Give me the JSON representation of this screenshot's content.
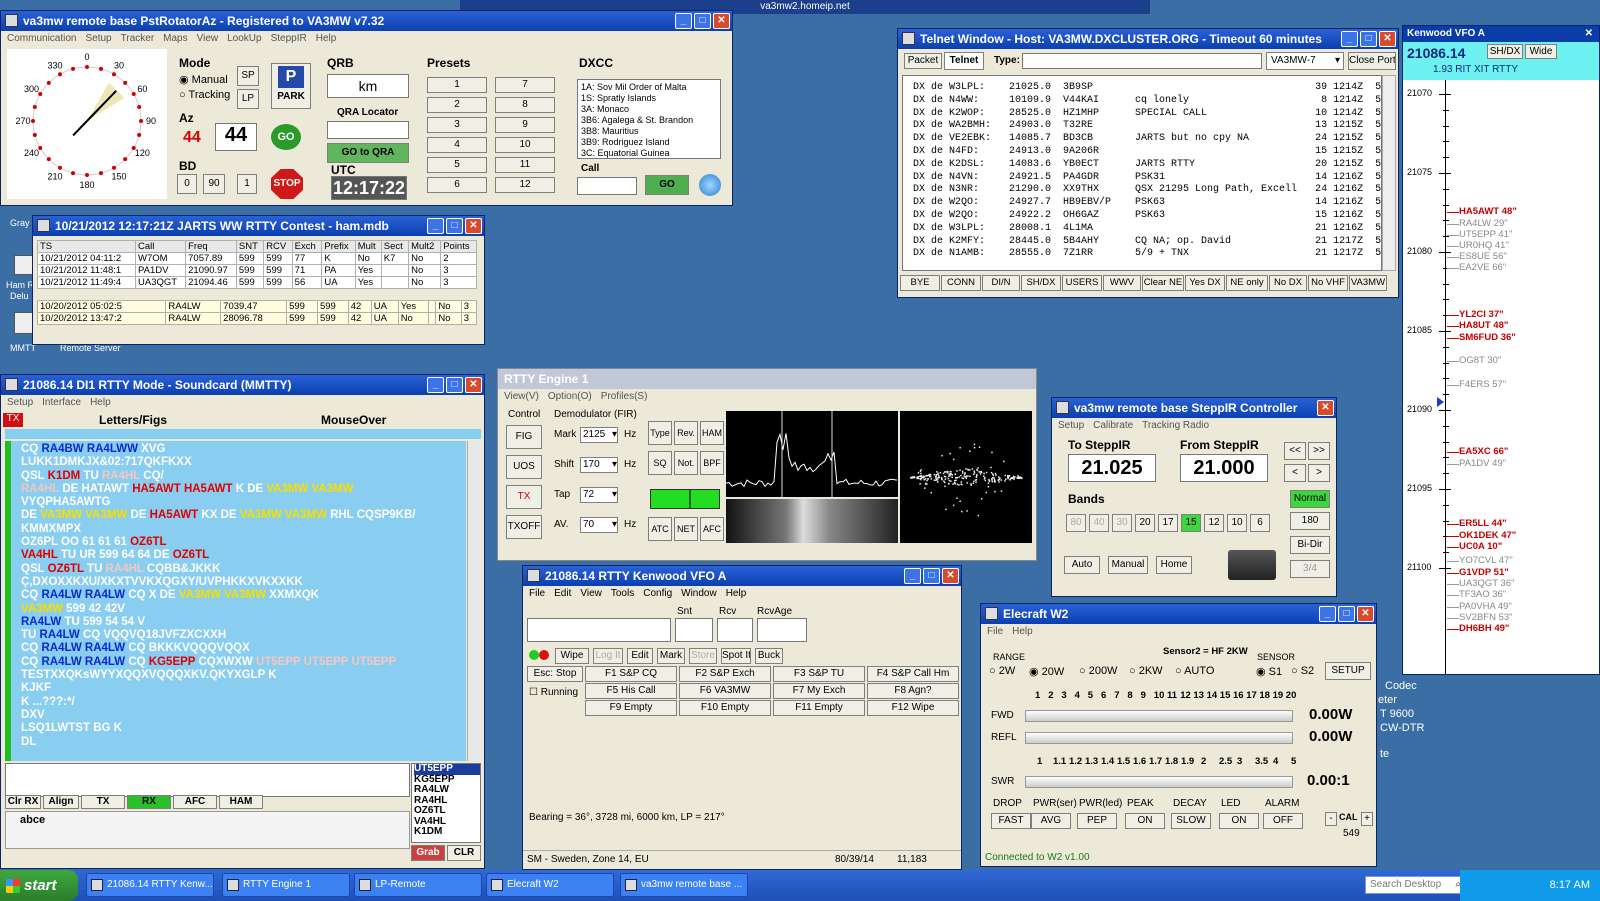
{
  "desktop": {
    "topbar_host": "va3mw2.homeip.net",
    "side_texts": [
      "Gray",
      "Ham R",
      "Delu",
      "MMTT",
      "Remote Server"
    ],
    "right_texts": [
      "Codec",
      "eter",
      "T 9600",
      "CW-DTR",
      "te"
    ]
  },
  "rotator": {
    "title": "va3mw remote base PstRotatorAz - Registered to VA3MW   v7.32",
    "menu": [
      "Communication",
      "Setup",
      "Tracker",
      "Maps",
      "View",
      "LookUp",
      "SteppIR",
      "Help"
    ],
    "compass": {
      "marks": [
        "330",
        "0",
        "30",
        "60",
        "90",
        "120",
        "150",
        "180",
        "210",
        "240",
        "270",
        "300"
      ],
      "heading_deg": 44
    },
    "mode_label": "Mode",
    "manual": "Manual",
    "tracking": "Tracking",
    "sp": "SP",
    "lp": "LP",
    "park": "PARK",
    "az_label": "Az",
    "az_value": "44",
    "az_input": "44",
    "go": "GO",
    "bd_label": "BD",
    "bd": [
      "0",
      "90",
      "1"
    ],
    "stop": "STOP",
    "qrb_label": "QRB",
    "km": "km",
    "qra_label": "QRA Locator",
    "go_qra": "GO to QRA",
    "utc_label": "UTC",
    "utc": "12:17:22",
    "presets_label": "Presets",
    "presets": [
      "1",
      "7",
      "2",
      "8",
      "3",
      "9",
      "4",
      "10",
      "5",
      "11",
      "6",
      "12"
    ],
    "dxcc_label": "DXCC",
    "dxcc": [
      "1A:  Sov Mil Order of Malta",
      "1S:  Spratly Islands",
      "3A:  Monaco",
      "3B6:  Agalega & St. Brandon",
      "3B8:  Mauritius",
      "3B9:  Rodriguez Island",
      "3C:  Equatorial Guinea"
    ],
    "call_label": "Call",
    "call_go": "GO"
  },
  "log": {
    "title": "10/21/2012 12:17:21Z  JARTS WW RTTY Contest - ham.mdb",
    "cols": [
      "TS",
      "Call",
      "Freq",
      "SNT",
      "RCV",
      "Exch",
      "Prefix",
      "Mult",
      "Sect",
      "Mult2",
      "Points"
    ],
    "rows": [
      [
        "10/21/2012 04:11:2",
        "W7OM",
        "7057.89",
        "599",
        "599",
        "77",
        "K",
        "No",
        "K7",
        "No",
        "2"
      ],
      [
        "10/21/2012 11:48:1",
        "PA1DV",
        "21090.97",
        "599",
        "599",
        "71",
        "PA",
        "Yes",
        "",
        "No",
        "3"
      ],
      [
        "10/21/2012 11:49:4",
        "UA3QGT",
        "21094.46",
        "599",
        "599",
        "56",
        "UA",
        "Yes",
        "",
        "No",
        "3"
      ]
    ],
    "rows2": [
      [
        "10/20/2012 05:02:5",
        "RA4LW",
        "7039.47",
        "599",
        "599",
        "42",
        "UA",
        "Yes",
        "",
        "No",
        "3"
      ],
      [
        "10/20/2012 13:47:2",
        "RA4LW",
        "28096.78",
        "599",
        "599",
        "42",
        "UA",
        "No",
        "",
        "No",
        "3"
      ]
    ]
  },
  "mmtty": {
    "title": "21086.14  DI1 RTTY Mode - Soundcard (MMTTY)",
    "menu": [
      "Setup",
      "Interface",
      "Help"
    ],
    "tx": "TX",
    "letters": "Letters/Figs",
    "mouseover": "MouseOver",
    "lines": [
      [
        [
          "CQ ",
          "w"
        ],
        [
          "RA4BW RA4LWW",
          "b"
        ],
        [
          " XVG",
          "w"
        ]
      ],
      [
        [
          "LUKK1DMKJX&02:717QKFKXX",
          "w"
        ]
      ],
      [
        [
          " QSL ",
          "w"
        ],
        [
          "K1DM",
          "r"
        ],
        [
          " TU ",
          "w"
        ],
        [
          "RA4HL",
          "g"
        ],
        [
          " CQ/",
          "w"
        ]
      ],
      [
        [
          "RA4HL",
          "g"
        ],
        [
          " DE HATAWT ",
          "w"
        ],
        [
          "HA5AWT HA5AWT",
          "r"
        ],
        [
          " K DE ",
          "w"
        ],
        [
          "VA3MW VA3MW",
          "y"
        ]
      ],
      [
        [
          "VYQPHA5AWTG",
          "w"
        ]
      ],
      [
        [
          " DE ",
          "w"
        ],
        [
          "VA3MW VA3MW",
          "y"
        ],
        [
          " DE ",
          "w"
        ],
        [
          "HA5AWT",
          "r"
        ],
        [
          " KX DE ",
          "w"
        ],
        [
          "VA3MW VA3MW",
          "y"
        ],
        [
          " RHL CQSP9KB/",
          "w"
        ]
      ],
      [
        [
          " KMMXMPX",
          "w"
        ]
      ],
      [
        [
          " OZ6PL OO 61 61 61 ",
          "w"
        ],
        [
          "OZ6TL",
          "r"
        ]
      ],
      [
        [
          "VA4HL",
          "r"
        ],
        [
          " TU UR 599 64 64 DE ",
          "w"
        ],
        [
          "OZ6TL",
          "r"
        ]
      ],
      [
        [
          " QSL ",
          "w"
        ],
        [
          "OZ6TL",
          "r"
        ],
        [
          " TU ",
          "w"
        ],
        [
          "RA4HL",
          "g"
        ],
        [
          " CQBB&JKKK",
          "w"
        ]
      ],
      [
        [
          "Ç,DXOXXKXU/XKXTVVKXQGXY/UVPHKKXVKXXKK",
          "w"
        ]
      ],
      [
        [
          "CQ ",
          "w"
        ],
        [
          "RA4LW RA4LW",
          "b"
        ],
        [
          " CQ X DE ",
          "w"
        ],
        [
          "VA3MW VA3MW",
          "y"
        ],
        [
          " XXMXQK",
          "w"
        ]
      ],
      [
        [
          "VA3MW",
          "y"
        ],
        [
          " 599 42 42V",
          "w"
        ]
      ],
      [
        [
          "RA4LW",
          "b"
        ],
        [
          " TU 599 54 54 V",
          "w"
        ]
      ],
      [
        [
          "TU ",
          "w"
        ],
        [
          "RA4LW",
          "b"
        ],
        [
          " CQ VQQVQ18JVFZXCXXH",
          "w"
        ]
      ],
      [
        [
          "CQ ",
          "w"
        ],
        [
          "RA4LW RA4LW",
          "b"
        ],
        [
          " CQ BKKKVQQQVQQX",
          "w"
        ]
      ],
      [
        [
          "CQ ",
          "w"
        ],
        [
          "RA4LW RA4LW",
          "b"
        ],
        [
          " CQ ",
          "w"
        ],
        [
          "KG5EPP",
          "r"
        ],
        [
          " CQXWXW ",
          "w"
        ],
        [
          "UT5EPP UT5EPP UT5EPP",
          "g"
        ]
      ],
      [
        [
          "TESTXXQKsWYYXQQXVQQQXKV.QKYXGLP K",
          "w"
        ]
      ],
      [
        [
          "KJKF",
          "w"
        ]
      ],
      [
        [
          " K ...???:*/",
          "w"
        ]
      ],
      [
        [
          "DXV",
          "w"
        ]
      ],
      [
        [
          "LSQ1LWTST BG  K",
          "w"
        ]
      ],
      [
        [
          " DL",
          "w"
        ]
      ]
    ],
    "calls": [
      "UT5EPP",
      "KG5EPP",
      "RA4LW",
      "RA4HL",
      "OZ6TL",
      "VA4HL",
      "K1DM"
    ],
    "bottom": [
      "Clr RX",
      "Align",
      "TX",
      "RX",
      "AFC",
      "HAM"
    ],
    "abce": "abce",
    "grab": "Grab",
    "clr": "CLR"
  },
  "engine": {
    "title": "RTTY Engine 1",
    "menu": [
      "View(V)",
      "Option(O)",
      "Profiles(S)"
    ],
    "control": "Control",
    "fig": "FIG",
    "uos": "UOS",
    "tx": "TX",
    "txoff": "TXOFF",
    "demod": "Demodulator (FIR)",
    "mark_l": "Mark",
    "mark": "2125",
    "shift_l": "Shift",
    "shift": "170",
    "tap_l": "Tap",
    "tap": "72",
    "av_l": "AV.",
    "av": "70",
    "hz": "Hz",
    "btns": [
      "Type",
      "Rev.",
      "HAM",
      "SQ",
      "Not.",
      "BPF",
      "ATC",
      "NET",
      "AFC"
    ]
  },
  "telnet": {
    "title": "Telnet Window - Host: VA3MW.DXCLUSTER.ORG - Timeout 60 minutes",
    "packet": "Packet",
    "telnet": "Telnet",
    "type": "Type:",
    "call": "VA3MW-7",
    "close": "Close Port",
    "lines": [
      "DX de W3LPL:    21025.0  3B9SP                                     39 1214Z  5",
      "DX de N4WW:     10109.9  V44KAI      cq lonely                      8 1214Z  5",
      "DX de K2WOP:    28525.0  HZ1MHP      SPECIAL CALL                  10 1214Z  5",
      "DX de WA2BMH:   24903.0  T32RE                                     13 1215Z  5",
      "DX de VE2EBK:   14085.7  BD3CB       JARTS but no cpy NA           24 1215Z  5",
      "DX de N4FD:     24913.0  9A206R                                    15 1215Z  5",
      "DX de K2DSL:    14083.6  YB0ECT      JARTS RTTY                    20 1215Z  5",
      "DX de N4VN:     24921.5  PA4GDR      PSK31                         14 1216Z  5",
      "DX de N3NR:     21290.0  XX9THX      QSX 21295 Long Path, Excell   24 1216Z  5",
      "DX de W2QO:     24927.7  HB9EBV/P    PSK63                         14 1216Z  5",
      "DX de W2QO:     24922.2  OH6GAZ      PSK63                         15 1216Z  5",
      "DX de W3LPL:    28008.1  4L1MA                                     21 1216Z  5",
      "DX de K2MFY:    28445.0  5B4AHY      CQ NA; op. David              21 1217Z  5",
      "DX de N1AMB:    28555.0  7Z1RR       5/9 + TNX                     21 1217Z  5"
    ],
    "buttons": [
      "BYE",
      "CONN",
      "DI/N",
      "SH/DX",
      "USERS",
      "WWV",
      "Clear NE",
      "Yes DX",
      "NE only",
      "No DX",
      "No VHF",
      "VA3MW"
    ]
  },
  "vfo": {
    "title": "Kenwood VFO A",
    "freq": "21086.14",
    "shdx": "SH/DX",
    "wide": "Wide",
    "sub": "1.93  RIT  XIT  RTTY",
    "ticks": [
      "21070",
      "21075",
      "21080",
      "21085",
      "21090",
      "21095",
      "21100"
    ],
    "spots": [
      [
        "HA5AWT 48\"",
        "r"
      ],
      [
        "RA4LW 29\"",
        "g"
      ],
      [
        "UT5EPP 41\"",
        "g"
      ],
      [
        "UR0HQ 41\"",
        "g"
      ],
      [
        "ES8UE 56\"",
        "g"
      ],
      [
        "EA2VE 66\"",
        "g"
      ],
      [
        "YL2CI 37\"",
        "r"
      ],
      [
        "HA8UT 48\"",
        "r"
      ],
      [
        "SM6FUD 36\"",
        "r"
      ],
      [
        "OG8T 30\"",
        "g"
      ],
      [
        "F4ERS 57\"",
        "g"
      ],
      [
        "EA5XC 66\"",
        "r"
      ],
      [
        "PA1DV 49\"",
        "g"
      ],
      [
        "ER5LL 44\"",
        "r"
      ],
      [
        "OK1DEK 47\"",
        "r"
      ],
      [
        "UC0A 10\"",
        "r"
      ],
      [
        "YO7CVL 47\"",
        "g"
      ],
      [
        "G1VDP 51\"",
        "r"
      ],
      [
        "UA3QGT 36\"",
        "g"
      ],
      [
        "TF3AO 36\"",
        "g"
      ],
      [
        "PA0VHA 49\"",
        "g"
      ],
      [
        "SV2BFN 53\"",
        "g"
      ],
      [
        "DH6BH 49\"",
        "r"
      ]
    ]
  },
  "steppir": {
    "title": "va3mw remote base SteppIR Controller",
    "menu": [
      "Setup",
      "Calibrate",
      "Tracking Radio"
    ],
    "to": "To SteppIR",
    "from": "From SteppIR",
    "to_val": "21.025",
    "from_val": "21.000",
    "bands_label": "Bands",
    "bands": [
      "80",
      "40",
      "30",
      "20",
      "17",
      "15",
      "12",
      "10",
      "6"
    ],
    "normal": "Normal",
    "d180": "180",
    "bidir": "Bi-Dir",
    "d34": "3/4",
    "auto": "Auto",
    "manual": "Manual",
    "home": "Home",
    "arrows": [
      "<<",
      ">>",
      "<",
      ">"
    ]
  },
  "kenwood": {
    "title": "21086.14  RTTY Kenwood VFO A",
    "menu": [
      "File",
      "Edit",
      "View",
      "Tools",
      "Config",
      "Window",
      "Help"
    ],
    "snt": "Snt",
    "rcv": "Rcv",
    "rcvage": "RcvAge",
    "tools": [
      "Wipe",
      "Log It",
      "Edit",
      "Mark",
      "Store",
      "Spot It",
      "Buck"
    ],
    "fkeys": [
      "Esc: Stop",
      "F1 S&P CQ",
      "F2 S&P Exch",
      "F3 S&P TU",
      "F4 S&P Call Hm",
      "F5 His Call",
      "F6 VA3MW",
      "F7 My Exch",
      "F8 Agn?",
      "F9 Empty",
      "F10 Empty",
      "F11 Empty",
      "F12 Wipe"
    ],
    "running": "Running",
    "bearing": "Bearing = 36°, 3728  mi, 6000 km, LP = 217°",
    "status": [
      "SM - Sweden, Zone 14, EU",
      "80/39/14",
      "11,183"
    ]
  },
  "elecraft": {
    "title": "Elecraft W2",
    "menu": [
      "File",
      "Help"
    ],
    "range": "RANGE",
    "ranges": [
      "2W",
      "20W",
      "200W",
      "2KW",
      "AUTO"
    ],
    "sensor_t": "Sensor2 = HF 2KW",
    "sensor": "SENSOR",
    "s1": "S1",
    "s2": "S2",
    "setup": "SETUP",
    "scale1": [
      "1",
      "2",
      "3",
      "4",
      "5",
      "6",
      "7",
      "8",
      "9",
      "10",
      "11",
      "12",
      "13",
      "14",
      "15",
      "16",
      "17",
      "18",
      "19",
      "20"
    ],
    "fwd": "FWD",
    "refl": "REFL",
    "fwd_v": "0.00W",
    "refl_v": "0.00W",
    "scale2": [
      "1",
      "1.1",
      "1.2",
      "1.3",
      "1.4",
      "1.5",
      "1.6",
      "1.7",
      "1.8",
      "1.9",
      "2",
      "2.5",
      "3",
      "3.5",
      "4",
      "5"
    ],
    "swr": "SWR",
    "swr_v": "0.00:1",
    "ctrl_l": [
      "DROP",
      "PWR(ser)",
      "PWR(led)",
      "PEAK",
      "DECAY",
      "LED",
      "ALARM"
    ],
    "ctrl_v": [
      "FAST",
      "AVG",
      "PEP",
      "ON",
      "SLOW",
      "ON",
      "OFF"
    ],
    "cal": "CAL",
    "cal_v": "549",
    "status": "Connected to W2 v1.00"
  },
  "taskbar": {
    "start": "start",
    "items": [
      "21086.14 RTTY Kenw...",
      "RTTY Engine 1",
      "LP-Remote",
      "Elecraft W2",
      "va3mw remote base ..."
    ],
    "search": "Search Desktop",
    "time": "8:17 AM"
  }
}
